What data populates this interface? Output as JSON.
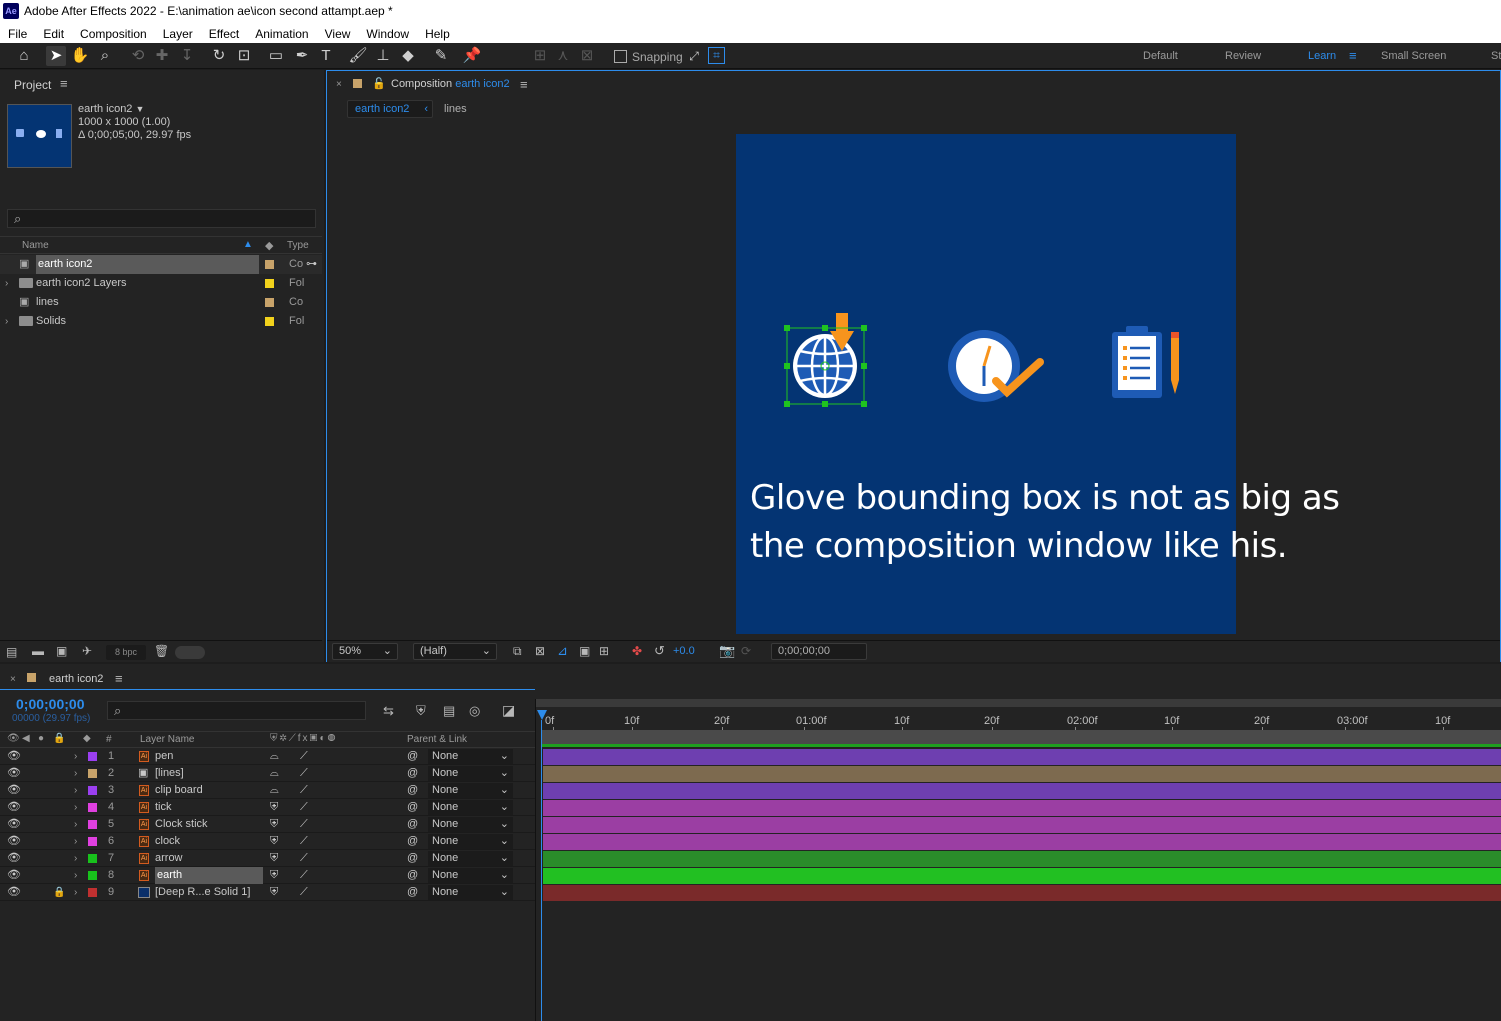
{
  "app": {
    "logo": "Ae",
    "window_title": "Adobe After Effects 2022 - E:\\animation ae\\icon second attampt.aep *"
  },
  "menu": [
    "File",
    "Edit",
    "Composition",
    "Layer",
    "Effect",
    "Animation",
    "View",
    "Window",
    "Help"
  ],
  "toolbar": {
    "snapping_label": "Snapping",
    "workspaces": [
      "Default",
      "Review",
      "Learn",
      "Small Screen",
      "St"
    ],
    "active_workspace": "Learn"
  },
  "project": {
    "panel_title": "Project",
    "comp_name": "earth icon2",
    "comp_size": "1000 x 1000 (1.00)",
    "comp_duration": "Δ 0;00;05;00, 29.97 fps",
    "col_name": "Name",
    "col_type": "Type",
    "items": [
      {
        "name": "earth icon2",
        "type": "Co",
        "kind": "comp",
        "color": "#c8a36a",
        "expand": false,
        "selected": true
      },
      {
        "name": "earth icon2 Layers",
        "type": "Fol",
        "kind": "folder",
        "color": "#f2d21c",
        "expand": true,
        "selected": false
      },
      {
        "name": "lines",
        "type": "Co",
        "kind": "comp",
        "color": "#c8a36a",
        "expand": false,
        "selected": false
      },
      {
        "name": "Solids",
        "type": "Fol",
        "kind": "folder",
        "color": "#f2d21c",
        "expand": true,
        "selected": false
      }
    ],
    "bpc": "8 bpc"
  },
  "composition": {
    "tab_prefix": "Composition",
    "tab_name": "earth icon2",
    "breadcrumb": [
      "earth icon2",
      "lines"
    ],
    "overlay_text_line1": "Glove bounding box is not as big as",
    "overlay_text_line2": "the composition window like his.",
    "zoom": "50%",
    "resolution": "(Half)",
    "exposure": "+0.0",
    "timecode": "0;00;00;00",
    "bg_color": "#043473"
  },
  "timeline": {
    "tab_name": "earth icon2",
    "timecode": "0;00;00;00",
    "frame_info": "00000 (29.97 fps)",
    "col_layer_name": "Layer Name",
    "col_parent": "Parent & Link",
    "ruler": [
      "0f",
      "10f",
      "20f",
      "01:00f",
      "10f",
      "20f",
      "02:00f",
      "10f",
      "20f",
      "03:00f",
      "10f"
    ],
    "layers": [
      {
        "num": "1",
        "name": "pen",
        "label": "#9b3ff0",
        "bar": "#6e3fb0",
        "locked": false,
        "selected": false
      },
      {
        "num": "2",
        "name": "[lines]",
        "label": "#c8a36a",
        "bar": "#7d6a4f",
        "locked": false,
        "selected": false
      },
      {
        "num": "3",
        "name": "clip board",
        "label": "#9b3ff0",
        "bar": "#6e3fb0",
        "locked": false,
        "selected": false
      },
      {
        "num": "4",
        "name": "tick",
        "label": "#e040e0",
        "bar": "#9b3ea3",
        "locked": false,
        "selected": false
      },
      {
        "num": "5",
        "name": "Clock stick",
        "label": "#e040e0",
        "bar": "#9b3ea3",
        "locked": false,
        "selected": false
      },
      {
        "num": "6",
        "name": "clock",
        "label": "#e040e0",
        "bar": "#9b3ea3",
        "locked": false,
        "selected": false
      },
      {
        "num": "7",
        "name": "arrow",
        "label": "#18c21c",
        "bar": "#2a8c2a",
        "locked": false,
        "selected": false
      },
      {
        "num": "8",
        "name": "earth",
        "label": "#18c21c",
        "bar": "#22c022",
        "locked": false,
        "selected": true
      },
      {
        "num": "9",
        "name": "[Deep R...e Solid 1]",
        "label": "#c03030",
        "bar": "#7a2a2a",
        "locked": true,
        "selected": false
      }
    ],
    "parent_value": "None"
  }
}
